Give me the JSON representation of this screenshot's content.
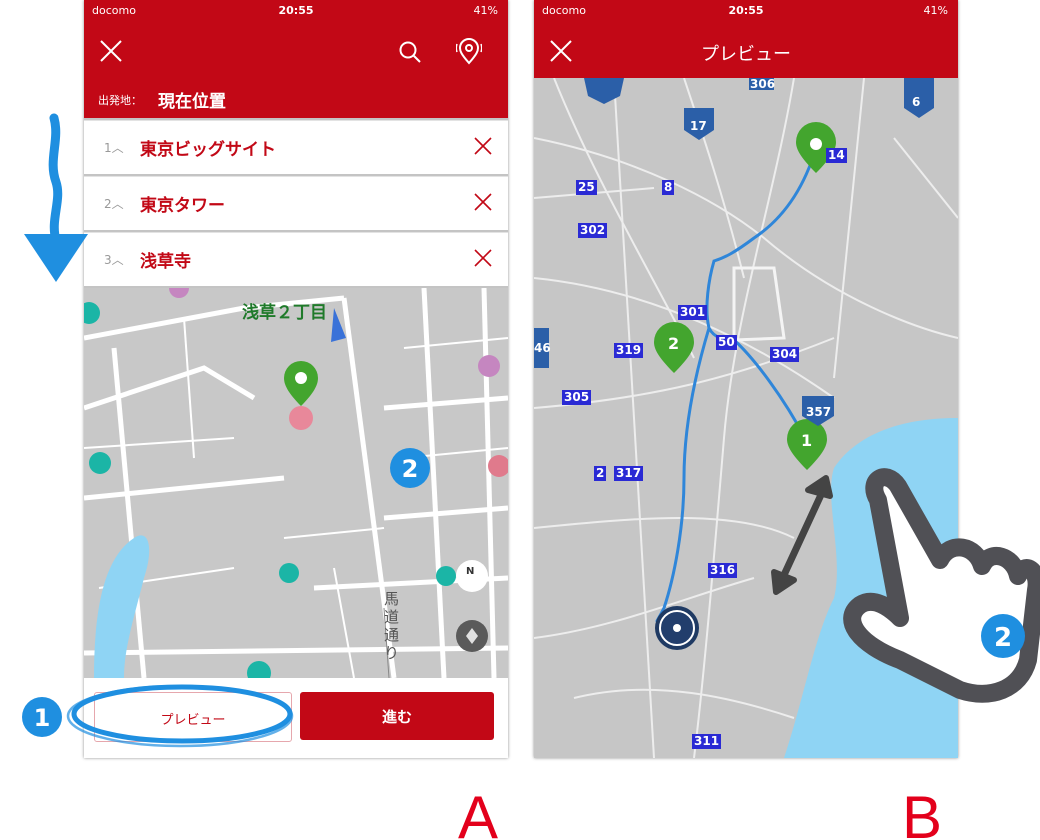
{
  "annotations": {
    "step1_marker": "1",
    "step2_marker": "2",
    "label_a": "A",
    "label_b": "B"
  },
  "screen_a": {
    "status": {
      "carrier": "docomo",
      "time": "20:55",
      "battery": "41%"
    },
    "nav_icons": [
      "close-icon",
      "search-icon",
      "location-pin-icon"
    ],
    "origin": {
      "label": "出発地：",
      "value": "現在位置"
    },
    "waypoints": [
      {
        "number": "1",
        "name": "東京ビッグサイト"
      },
      {
        "number": "2",
        "name": "東京タワー"
      },
      {
        "number": "3",
        "name": "浅草寺"
      }
    ],
    "map": {
      "area_label": "浅草２丁目",
      "street_label": "馬道通り"
    },
    "preview_button": "プレビュー",
    "go_button": "進む"
  },
  "screen_b": {
    "status": {
      "carrier": "docomo",
      "time": "20:55",
      "battery": "41%"
    },
    "title": "プレビュー",
    "route_shields": [
      "306",
      "17",
      "6",
      "25",
      "8",
      "302",
      "301",
      "319",
      "50",
      "304",
      "305",
      "357",
      "317",
      "316",
      "311",
      "46",
      "2",
      "14",
      "2"
    ],
    "pins": [
      {
        "label": "2"
      },
      {
        "label": "1"
      }
    ]
  },
  "colors": {
    "header_red": "#c20816",
    "route_blue": "#2f86d9",
    "pin_green": "#43a52e",
    "annotation_blue": "#1f8fe0",
    "label_red": "#e3001b",
    "water": "#8fd4f4"
  }
}
